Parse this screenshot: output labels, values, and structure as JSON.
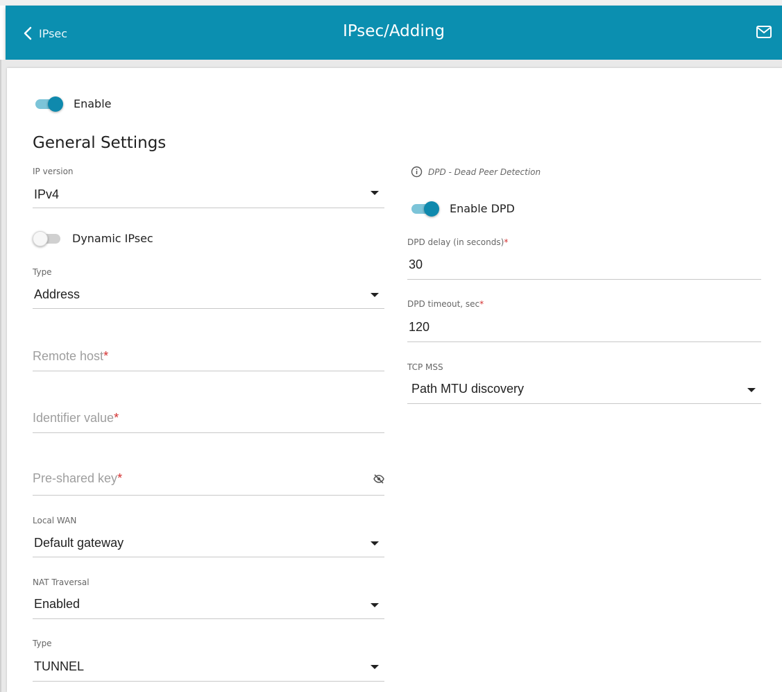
{
  "header": {
    "back_label": "IPsec",
    "title": "IPsec/Adding",
    "background_color": "#0b8fb0"
  },
  "enable_toggle": {
    "label": "Enable",
    "on": true
  },
  "general_settings": {
    "title": "General Settings",
    "ip_version": {
      "label": "IP version",
      "value": "IPv4"
    },
    "dynamic_ipsec": {
      "label": "Dynamic IPsec",
      "on": false
    },
    "type": {
      "label": "Type",
      "value": "Address"
    },
    "remote_host": {
      "placeholder": "Remote host",
      "required_mark": "*"
    },
    "identifier_value": {
      "placeholder": "Identifier value",
      "required_mark": "*"
    },
    "pre_shared_key": {
      "placeholder": "Pre-shared key",
      "required_mark": "*"
    },
    "local_wan": {
      "label": "Local WAN",
      "value": "Default gateway"
    },
    "nat_traversal": {
      "label": "NAT Traversal",
      "value": "Enabled"
    },
    "mode_type": {
      "label": "Type",
      "value": "TUNNEL"
    }
  },
  "dpd": {
    "note": "DPD - Dead Peer Detection",
    "enable_dpd": {
      "label": "Enable DPD",
      "on": true
    },
    "delay": {
      "label": "DPD delay (in seconds)",
      "required_mark": "*",
      "value": "30"
    },
    "timeout": {
      "label": "DPD timeout, sec",
      "required_mark": "*",
      "value": "120"
    },
    "tcp_mss": {
      "label": "TCP MSS",
      "value": "Path MTU discovery"
    }
  },
  "icons": {
    "back": "chevron-left-icon",
    "mail": "mail-icon",
    "info": "info-icon",
    "visibility": "eye-off-icon",
    "dropdown": "caret-down-icon"
  },
  "colors": {
    "accent": "#0f89ad",
    "required": "#d32f2f"
  }
}
